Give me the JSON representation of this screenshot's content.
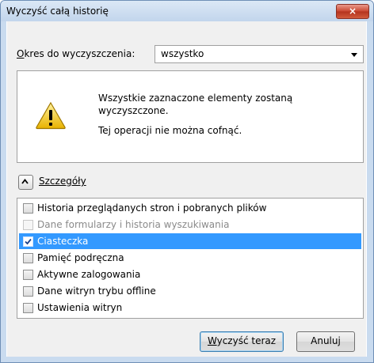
{
  "window": {
    "title": "Wyczyść całą historię",
    "close_label": "×"
  },
  "period": {
    "label_accel": "O",
    "label_rest": "kres do wyczyszczenia:",
    "selected": "wszystko"
  },
  "warning": {
    "line1": "Wszystkie zaznaczone elementy zostaną wyczyszczone.",
    "line2": "Tej operacji nie można cofnąć."
  },
  "details": {
    "label": "Szczegóły",
    "expanded": true
  },
  "items": [
    {
      "label": "Historia przeglądanych stron i pobranych plików",
      "checked": false,
      "disabled": false,
      "selected": false
    },
    {
      "label": "Dane formularzy i historia wyszukiwania",
      "checked": false,
      "disabled": true,
      "selected": false
    },
    {
      "label": "Ciasteczka",
      "checked": true,
      "disabled": false,
      "selected": true
    },
    {
      "label": "Pamięć podręczna",
      "checked": false,
      "disabled": false,
      "selected": false
    },
    {
      "label": "Aktywne zalogowania",
      "checked": false,
      "disabled": false,
      "selected": false
    },
    {
      "label": "Dane witryn trybu offline",
      "checked": false,
      "disabled": false,
      "selected": false
    },
    {
      "label": "Ustawienia witryn",
      "checked": false,
      "disabled": false,
      "selected": false
    }
  ],
  "buttons": {
    "clear_accel": "W",
    "clear_rest": "yczyść teraz",
    "cancel": "Anuluj"
  },
  "colors": {
    "selection": "#3399ff",
    "close_button": "#c9452f",
    "title_bar": "#c2d5ec",
    "warning_yellow": "#f5c400"
  }
}
